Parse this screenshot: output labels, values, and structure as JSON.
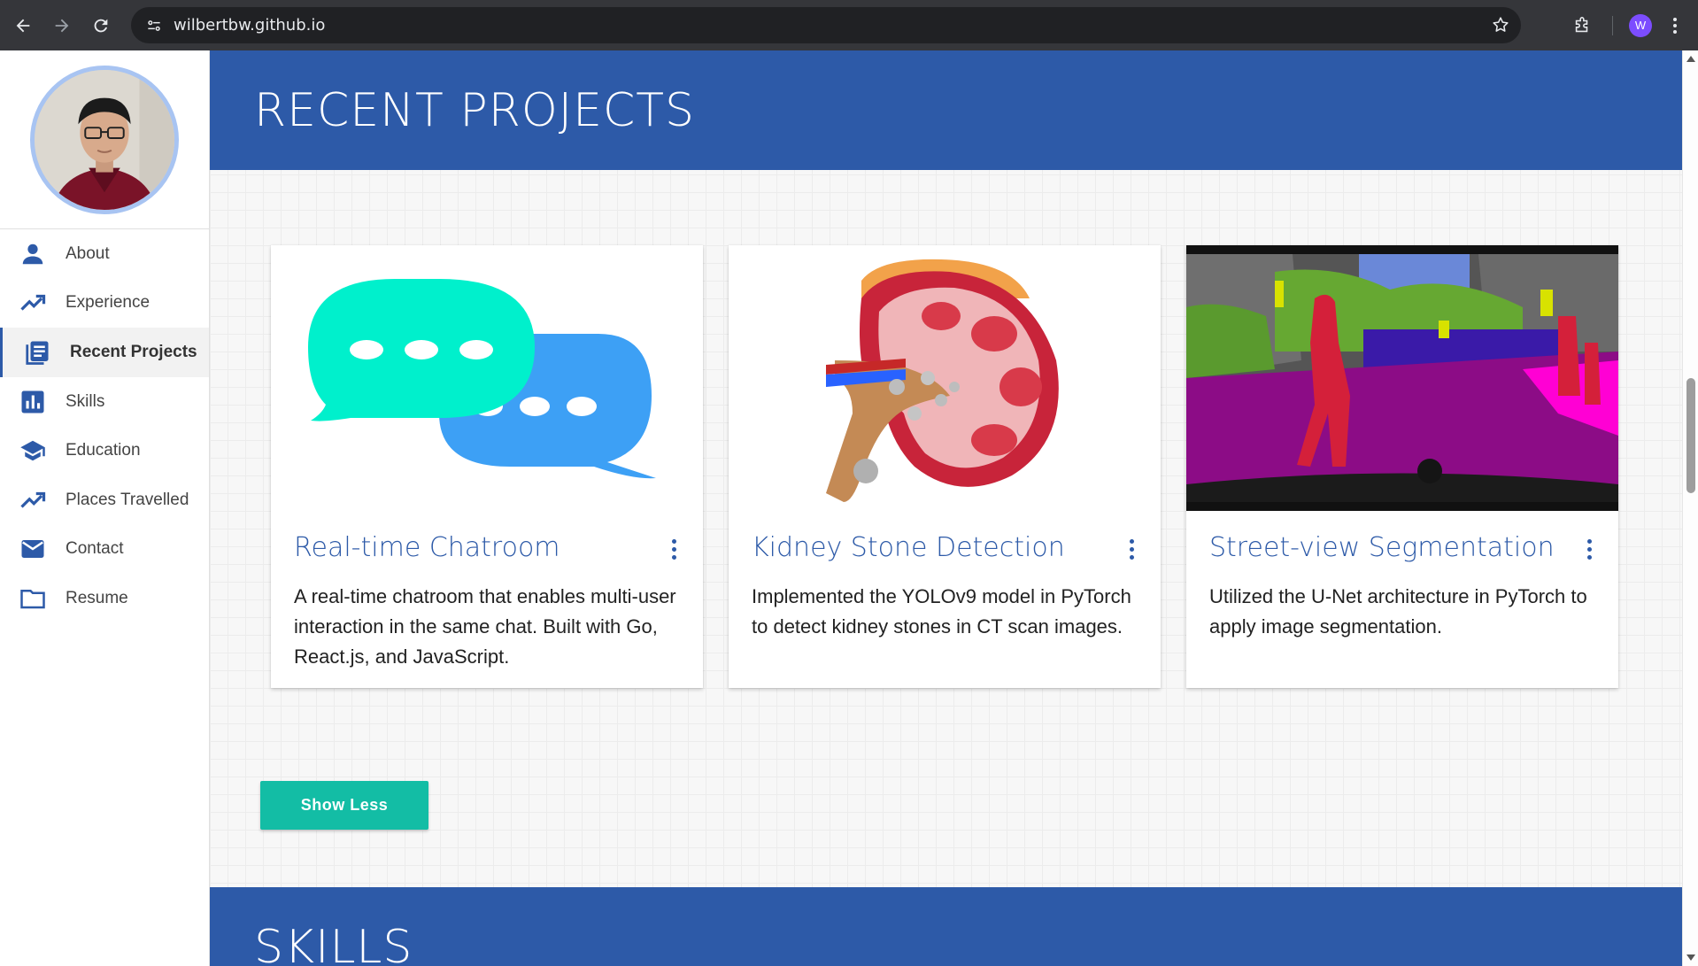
{
  "browser": {
    "url": "wilbertbw.github.io",
    "profile_initial": "W"
  },
  "sidebar": {
    "items": [
      {
        "label": "About",
        "icon": "person-icon"
      },
      {
        "label": "Experience",
        "icon": "trending-up-icon"
      },
      {
        "label": "Recent Projects",
        "icon": "article-icon",
        "active": true
      },
      {
        "label": "Skills",
        "icon": "bar-chart-icon"
      },
      {
        "label": "Education",
        "icon": "graduation-cap-icon"
      },
      {
        "label": "Places Travelled",
        "icon": "trending-up-icon"
      },
      {
        "label": "Contact",
        "icon": "mail-icon"
      },
      {
        "label": "Resume",
        "icon": "folder-icon"
      }
    ]
  },
  "main": {
    "section_title": "RECENT PROJECTS",
    "next_section_title": "SKILLS",
    "projects": [
      {
        "title": "Real-time Chatroom",
        "description": "A real-time chatroom that enables multi-user interaction in the same chat. Built with Go, React.js, and JavaScript."
      },
      {
        "title": "Kidney Stone Detection",
        "description": "Implemented the YOLOv9 model in PyTorch to detect kidney stones in CT scan images."
      },
      {
        "title": "Street-view Segmentation",
        "description": "Utilized the U-Net architecture in PyTorch to apply image segmentation."
      }
    ],
    "show_less_label": "Show Less"
  },
  "colors": {
    "brand_blue": "#2d5aa8",
    "button_teal": "#13bda5"
  }
}
